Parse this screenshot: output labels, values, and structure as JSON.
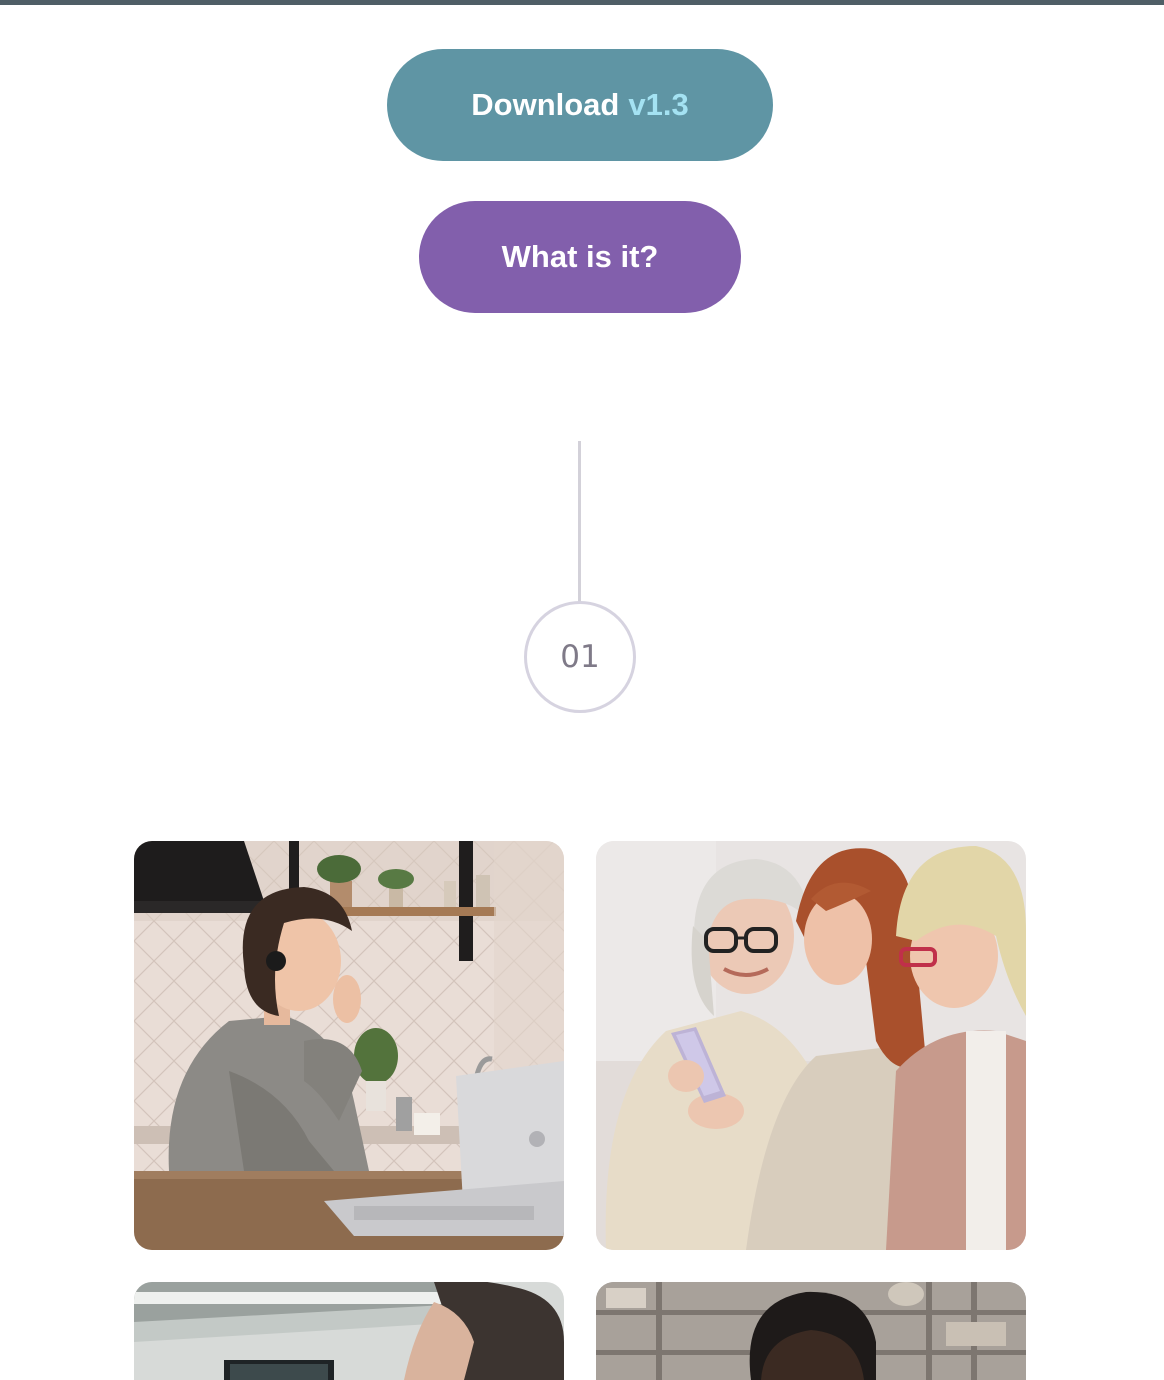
{
  "buttons": {
    "download_label": "Download",
    "download_version": "v1.3",
    "what_is_it_label": "What is it?"
  },
  "steps": {
    "first_number": "01"
  },
  "colors": {
    "top_bar": "#4f5e66",
    "download_bg": "#5f95a4",
    "download_version": "#a4e2f2",
    "what_bg": "#825fac",
    "step_border": "#d6d3e0"
  }
}
